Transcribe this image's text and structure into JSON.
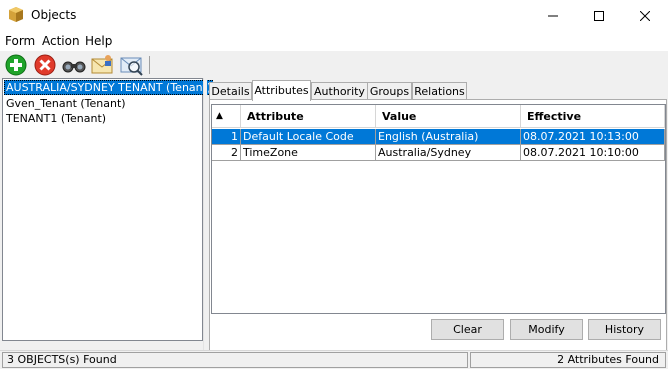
{
  "window": {
    "title": "Objects",
    "icon": "cube-icon"
  },
  "menu": [
    "Form",
    "Action",
    "Help"
  ],
  "toolbar": [
    {
      "icon": "add-icon",
      "color": "#1fa32a"
    },
    {
      "icon": "delete-icon",
      "color": "#e03a2b"
    },
    {
      "icon": "binoculars-icon"
    },
    {
      "icon": "envelope-person-icon"
    },
    {
      "icon": "envelope-search-icon"
    }
  ],
  "tree": [
    {
      "label": "AUSTRALIA/SYDNEY TENANT  (Tenant)",
      "selected": true
    },
    {
      "label": "Gven_Tenant  (Tenant)",
      "selected": false
    },
    {
      "label": "TENANT1  (Tenant)",
      "selected": false
    }
  ],
  "tabs": [
    {
      "label": "Details",
      "active": false
    },
    {
      "label": "Attributes",
      "active": true
    },
    {
      "label": "Authority",
      "active": false
    },
    {
      "label": "Groups",
      "active": false
    },
    {
      "label": "Relations",
      "active": false
    }
  ],
  "grid": {
    "sort_indicator": "▲",
    "columns": [
      "Attribute",
      "Value",
      "Effective"
    ],
    "rows": [
      {
        "num": "1",
        "attribute": "Default Locale Code",
        "value": "English (Australia)",
        "effective": "08.07.2021 10:13:00",
        "selected": true
      },
      {
        "num": "2",
        "attribute": "TimeZone",
        "value": "Australia/Sydney",
        "effective": "08.07.2021 10:10:00",
        "selected": false
      }
    ]
  },
  "buttons": {
    "clear": "Clear",
    "modify": "Modify",
    "history": "History"
  },
  "status": {
    "left": "3 OBJECTS(s) Found",
    "right": "2 Attributes Found"
  },
  "colors": {
    "selection": "#0078d7"
  }
}
